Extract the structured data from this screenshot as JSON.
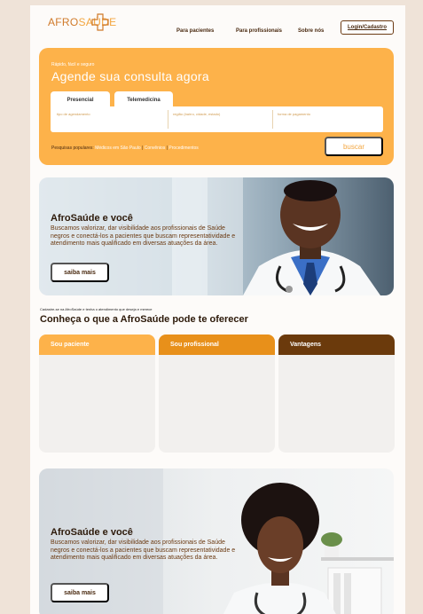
{
  "header": {
    "logo_part1": "AFRO",
    "logo_part2": "SAÚDE",
    "nav": [
      "Para pacientes",
      "Para profissionais",
      "Sobre nós"
    ],
    "login_label": "Login/Cadastro"
  },
  "search": {
    "kicker": "Rápido, fácil e seguro",
    "title": "Agende sua consulta agora",
    "tabs": [
      "Presencial",
      "Telemedicina"
    ],
    "fields": [
      "tipo de agendamento",
      "região (bairro, cidade, estado)",
      "forma de pagamento"
    ],
    "popular_label": "Pesquisas populares:",
    "popular_links": [
      "Médicos em São Paulo",
      "Convênios",
      "Procedimentos"
    ],
    "button": "buscar"
  },
  "hero1": {
    "title": "AfroSaúde e você",
    "body": "Buscamos valorizar, dar visibilidade aos profissionais de Saúde negros e conectá-los a pacientes que buscam representatividade e atendimento mais qualificado em diversas atuações da área.",
    "button": "saiba mais"
  },
  "offers": {
    "kicker": "Cadastre-se na AfroSaúde e tenha o atendimento que deseja e merece",
    "title": "Conheça o que a AfroSaúde pode te oferecer",
    "cards": [
      {
        "label": "Sou paciente",
        "color": "#fdb24a"
      },
      {
        "label": "Sou profissional",
        "color": "#e8901a"
      },
      {
        "label": "Vantagens",
        "color": "#6b3a0c"
      }
    ]
  },
  "hero2": {
    "title": "AfroSaúde e você",
    "body": "Buscamos valorizar, dar visibilidade aos profissionais de Saúde negros e conectá-los a pacientes que buscam representatividade e atendimento mais qualificado em diversas atuações da área.",
    "button": "saiba mais"
  },
  "colors": {
    "accent": "#fdb24a",
    "dark_brown": "#6b3a0c",
    "text_brown": "#4a2a10"
  }
}
